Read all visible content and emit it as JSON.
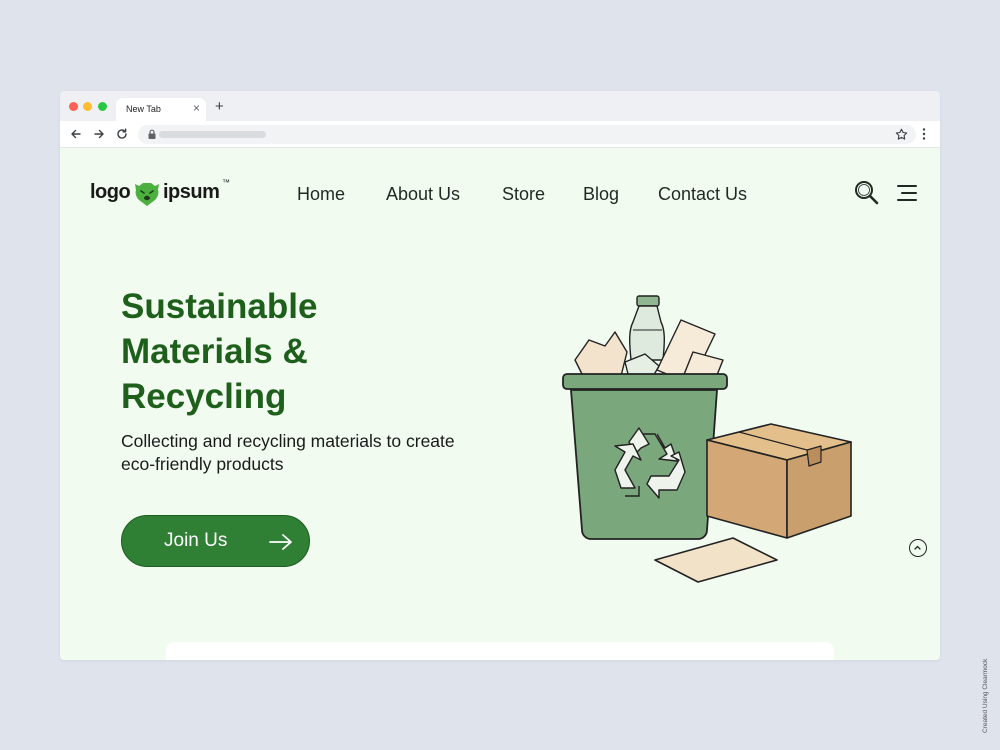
{
  "browser": {
    "tab_title": "New Tab",
    "tab_close": "×",
    "new_tab": "+"
  },
  "logo": {
    "part1": "logo",
    "part2": "ipsum",
    "mark": "™"
  },
  "nav": {
    "items": [
      {
        "label": "Home"
      },
      {
        "label": "About Us"
      },
      {
        "label": "Store"
      },
      {
        "label": "Blog"
      },
      {
        "label": "Contact Us"
      }
    ]
  },
  "hero": {
    "title_lines": [
      "Sustainable",
      "Materials &",
      "Recycling"
    ],
    "subtitle": "Collecting and recycling materials to create eco-friendly products",
    "cta_label": "Join Us"
  },
  "icons": {
    "search": "search-icon",
    "menu": "hamburger-menu-icon",
    "arrow": "arrow-right-icon",
    "scroll_top": "chevron-up-icon"
  },
  "colors": {
    "page_bg": "#f1fbf0",
    "title_green": "#1f5f1c",
    "button_green": "#2f7f35",
    "bin_green": "#7aa77c",
    "box_tan": "#d3a876"
  },
  "credit": "Created Using Clearmock"
}
